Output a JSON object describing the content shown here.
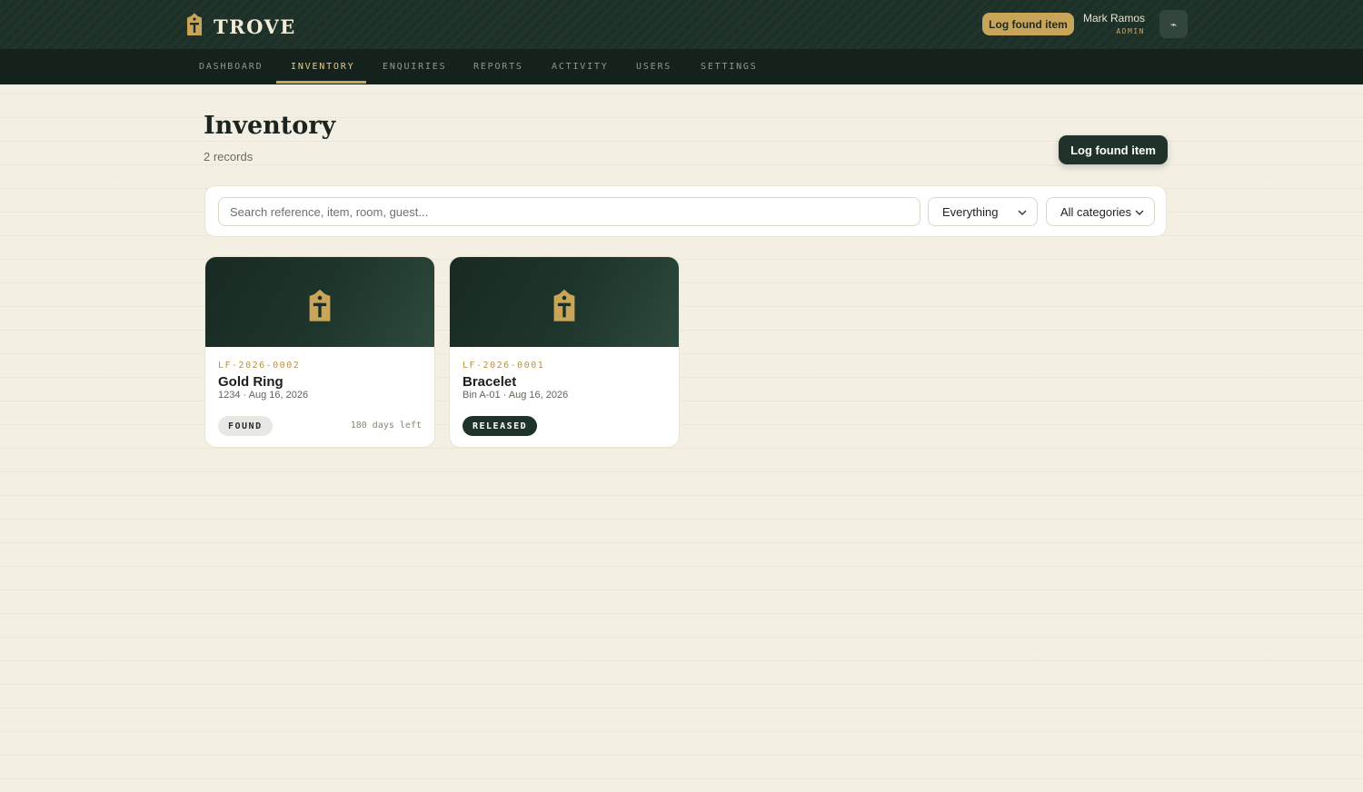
{
  "brand": {
    "name": "TROVE",
    "icon": "tag-icon"
  },
  "header": {
    "cta_label": "Log found item",
    "user_name": "Mark Ramos",
    "user_role": "ADMIN",
    "user_button_glyph": "⌁"
  },
  "nav": {
    "items": [
      {
        "label": "DASHBOARD",
        "active": false
      },
      {
        "label": "INVENTORY",
        "active": true
      },
      {
        "label": "ENQUIRIES",
        "active": false
      },
      {
        "label": "REPORTS",
        "active": false
      },
      {
        "label": "ACTIVITY",
        "active": false
      },
      {
        "label": "USERS",
        "active": false
      },
      {
        "label": "SETTINGS",
        "active": false
      }
    ]
  },
  "page": {
    "title": "Inventory",
    "record_count": "2 records",
    "cta_label": "Log found item"
  },
  "filters": {
    "search_placeholder": "Search reference, item, room, guest...",
    "search_value": "",
    "status_selected": "Everything",
    "category_selected": "All categories"
  },
  "cards": [
    {
      "ref": "LF-2026-0002",
      "title": "Gold Ring",
      "meta": "1234 · Aug 16, 2026",
      "status": "FOUND",
      "days_left": "180 days left"
    },
    {
      "ref": "LF-2026-0001",
      "title": "Bracelet",
      "meta": "Bin A-01 · Aug 16, 2026",
      "status": "RELEASED",
      "days_left": ""
    }
  ],
  "colors": {
    "header_bg": "#1e3128",
    "nav_bg": "#15221c",
    "accent_gold": "#c9a55a",
    "page_bg": "#f3efe3",
    "primary_dark": "#1f332a"
  }
}
